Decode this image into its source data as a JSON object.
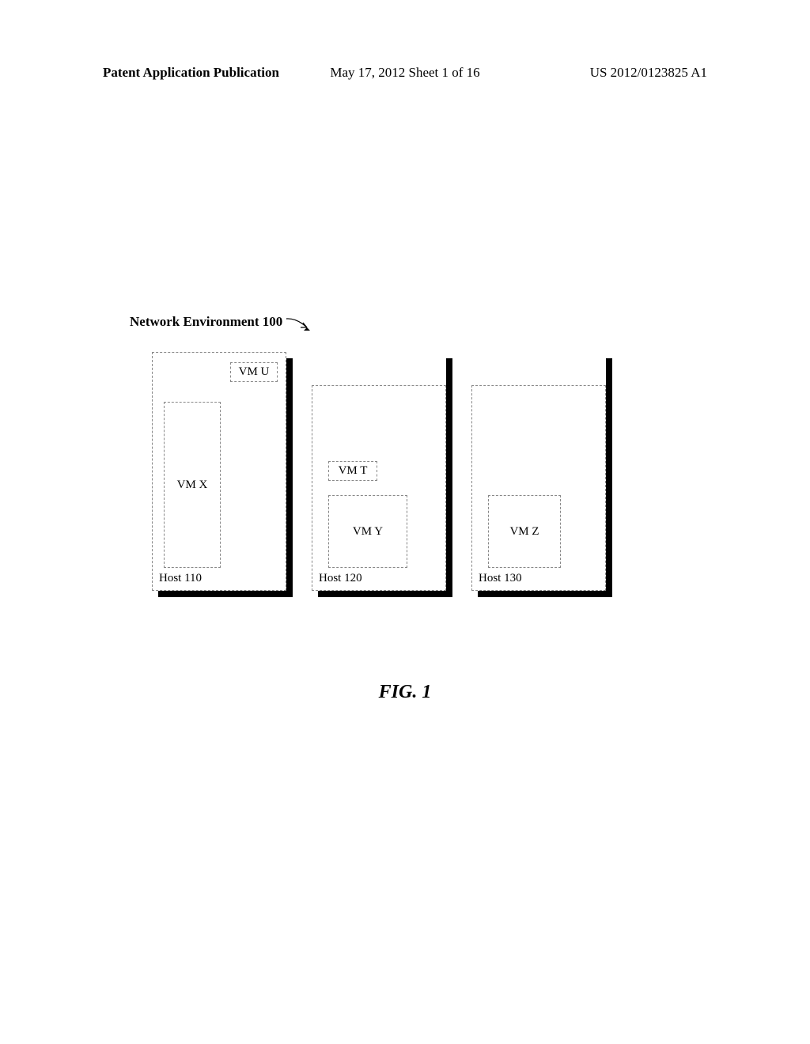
{
  "header": {
    "left": "Patent Application Publication",
    "center": "May 17, 2012  Sheet 1 of 16",
    "right": "US 2012/0123825 A1"
  },
  "diagram": {
    "env_label": "Network Environment 100",
    "hosts": [
      {
        "label": "Host 110",
        "vms": [
          {
            "name": "VM U",
            "class": "vm-u"
          },
          {
            "name": "VM X",
            "class": "vm-x"
          }
        ]
      },
      {
        "label": "Host 120",
        "vms": [
          {
            "name": "VM T",
            "class": "vm-t"
          },
          {
            "name": "VM Y",
            "class": "vm-y"
          }
        ]
      },
      {
        "label": "Host 130",
        "vms": [
          {
            "name": "VM Z",
            "class": "vm-z"
          }
        ]
      }
    ]
  },
  "figure_label": "FIG. 1"
}
